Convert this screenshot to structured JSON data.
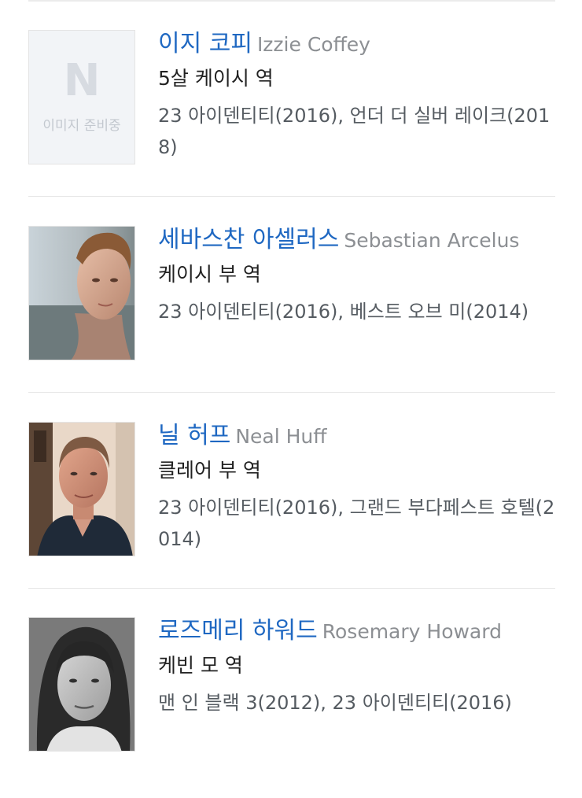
{
  "cast": [
    {
      "name_ko": "이지 코피",
      "name_en": "Izzie Coffey",
      "role": "5살 케이시 역",
      "works": "23 아이덴티티(2016), 언더 더 실버 레이크(2018)",
      "photo": "placeholder",
      "placeholder_letter": "N",
      "placeholder_text": "이미지 준비중"
    },
    {
      "name_ko": "세바스찬 아셀러스",
      "name_en": "Sebastian Arcelus",
      "role": "케이시 부 역",
      "works": "23 아이덴티티(2016), 베스트 오브 미(2014)",
      "photo": "actor-photo"
    },
    {
      "name_ko": "닐 허프",
      "name_en": "Neal Huff",
      "role": "클레어 부 역",
      "works": "23 아이덴티티(2016), 그랜드 부다페스트 호텔(2014)",
      "photo": "actor-photo"
    },
    {
      "name_ko": "로즈메리 하워드",
      "name_en": "Rosemary Howard",
      "role": "케빈 모 역",
      "works": "맨 인 블랙 3(2012), 23 아이덴티티(2016)",
      "photo": "actor-photo-bw"
    }
  ],
  "colors": {
    "name_ko": "#1f68c2",
    "name_en": "#8c8f93",
    "role": "#222222",
    "works": "#555b61",
    "divider": "#e6e6e6"
  }
}
